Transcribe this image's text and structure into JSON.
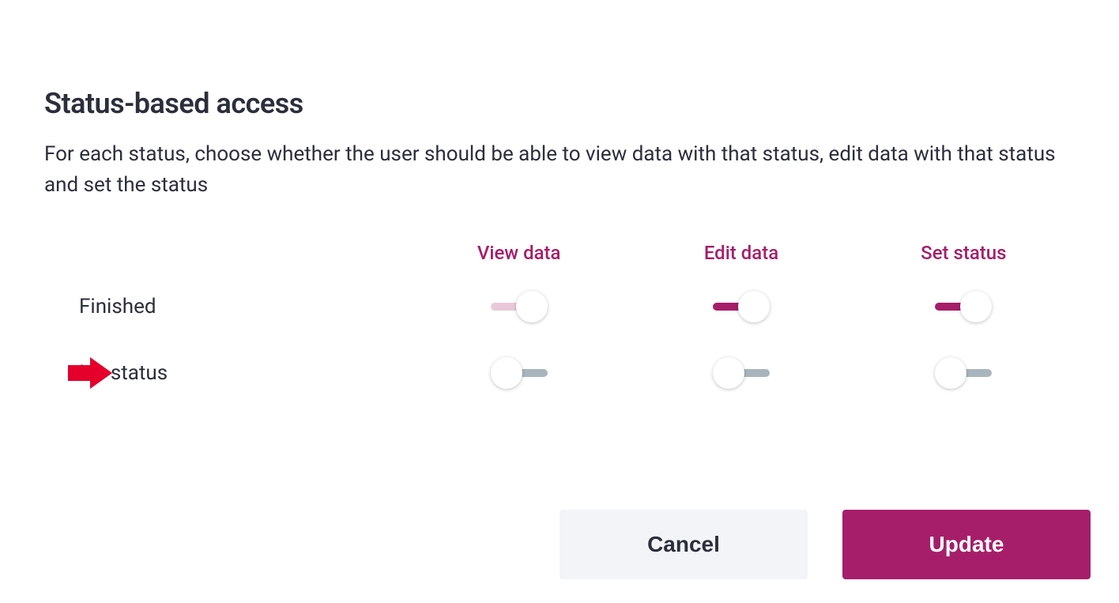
{
  "title": "Status-based access",
  "description": "For each status, choose whether the user should be able to view data with that status, edit data with that status and set the status",
  "columns": {
    "view": "View data",
    "edit": "Edit data",
    "set": "Set status"
  },
  "rows": [
    {
      "label": "Finished",
      "highlighted": false,
      "toggles": {
        "view": {
          "on": true,
          "disabled": true
        },
        "edit": {
          "on": true,
          "disabled": false
        },
        "set": {
          "on": true,
          "disabled": false
        }
      }
    },
    {
      "label": "No status",
      "highlighted": true,
      "toggles": {
        "view": {
          "on": false,
          "disabled": false
        },
        "edit": {
          "on": false,
          "disabled": false
        },
        "set": {
          "on": false,
          "disabled": false
        }
      }
    }
  ],
  "buttons": {
    "cancel": "Cancel",
    "update": "Update"
  }
}
